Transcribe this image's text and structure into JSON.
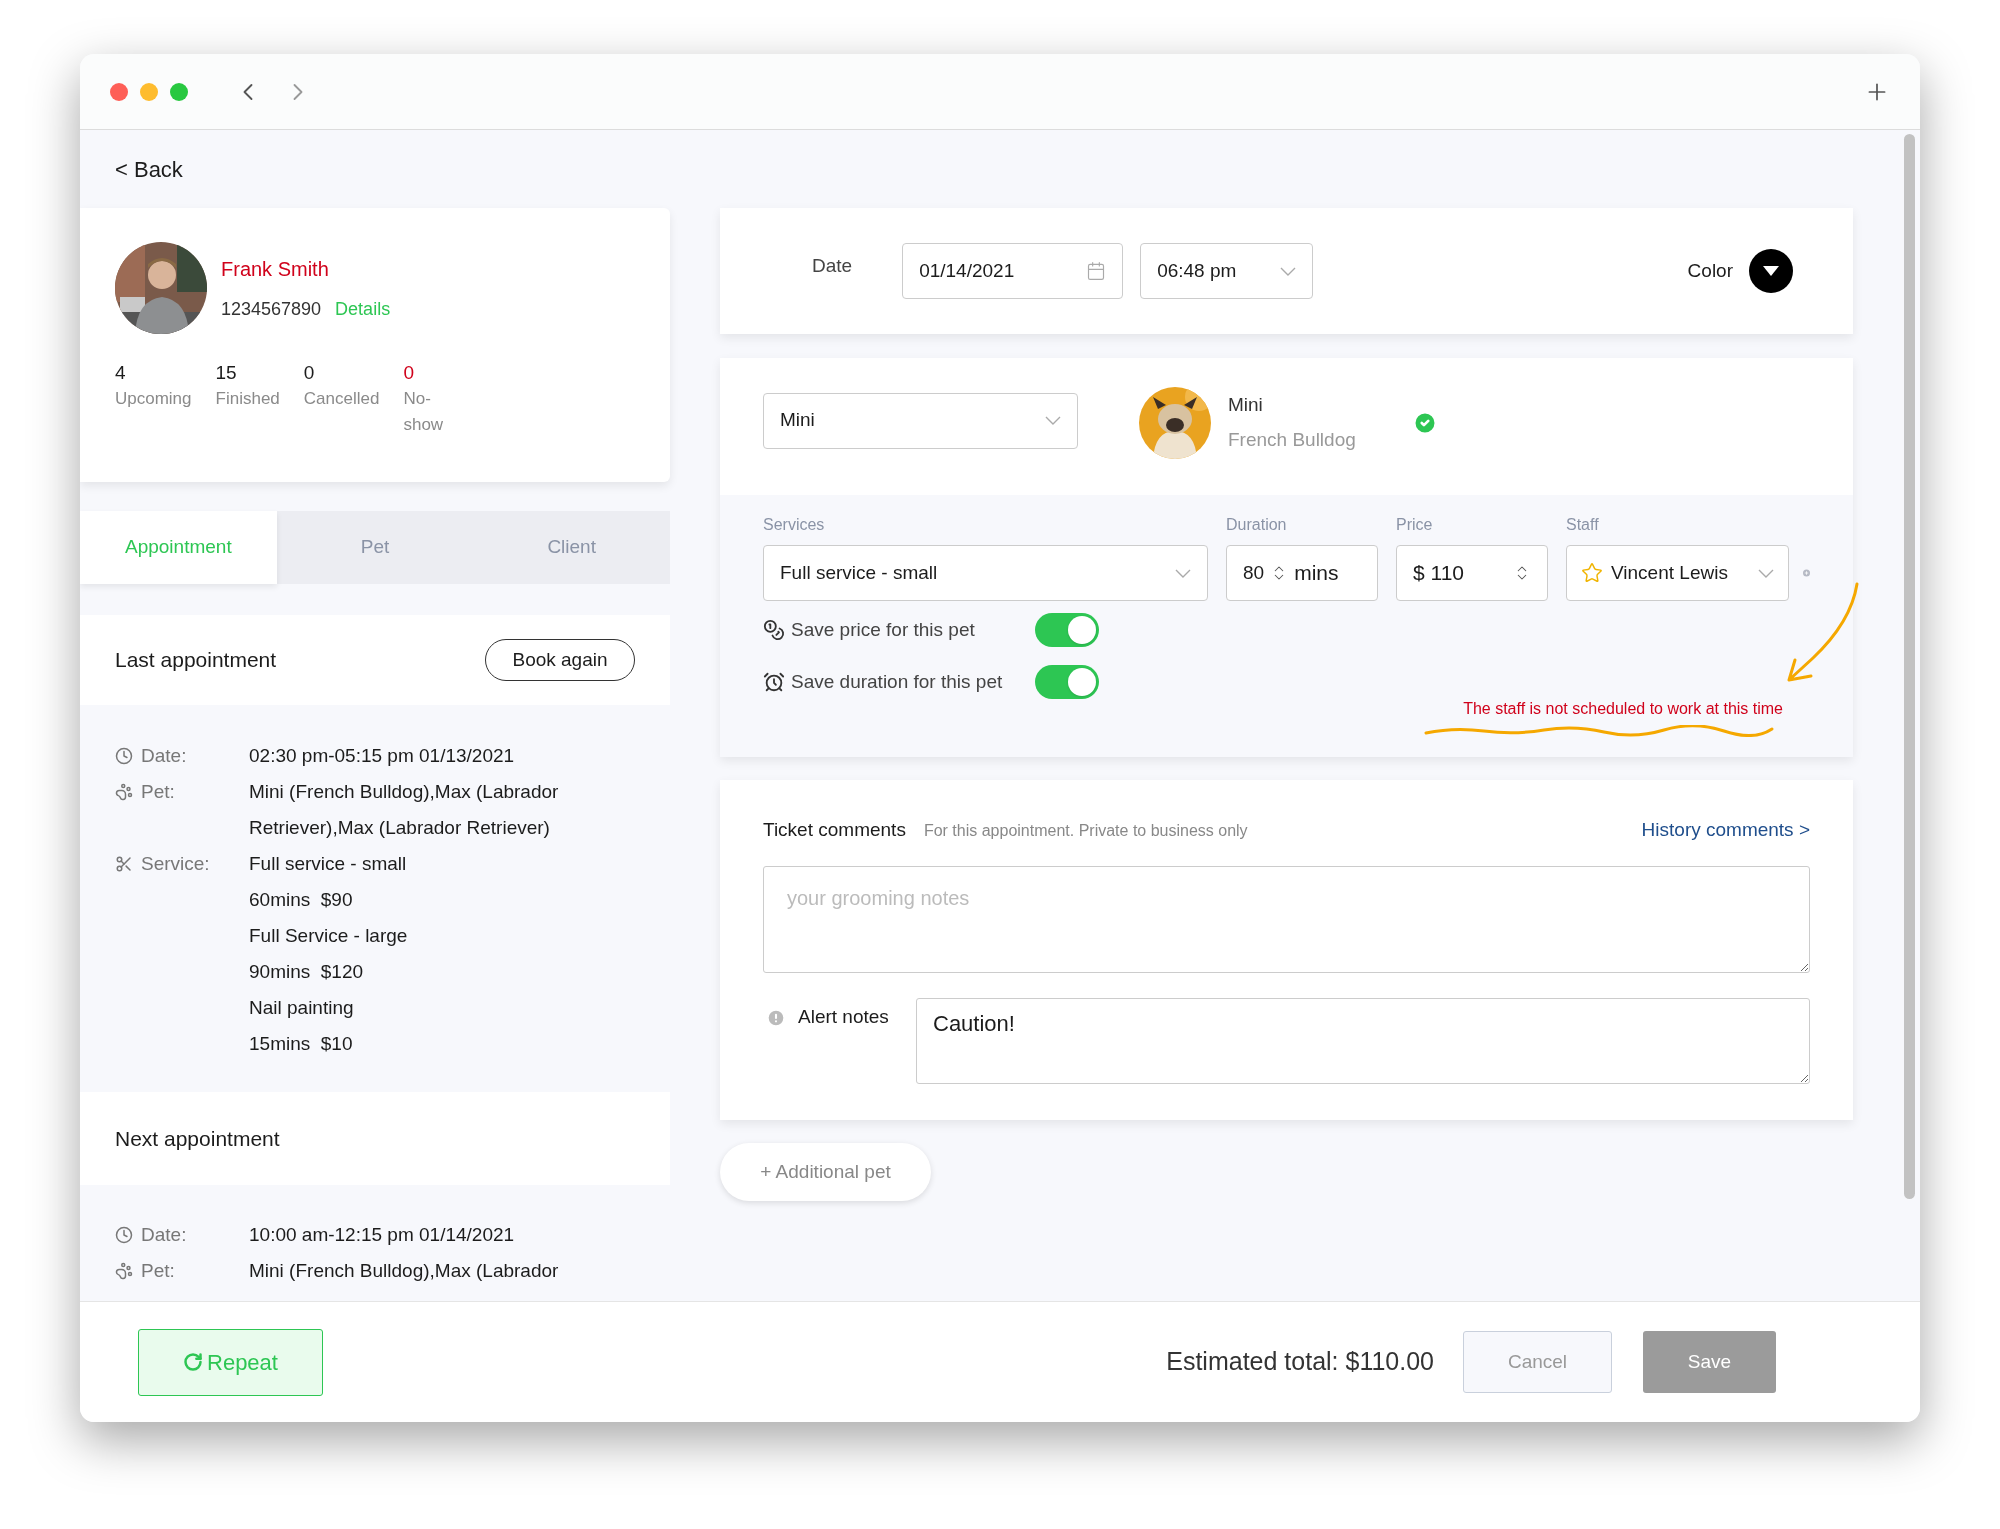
{
  "back_link": "< Back",
  "client": {
    "name": "Frank Smith",
    "phone": "1234567890",
    "details_link": "Details",
    "stats": [
      {
        "value": "4",
        "label": "Upcoming",
        "alert": false
      },
      {
        "value": "15",
        "label": "Finished",
        "alert": false
      },
      {
        "value": "0",
        "label": "Cancelled",
        "alert": false
      },
      {
        "value": "0",
        "label": "No-show",
        "alert": true
      }
    ]
  },
  "tabs": [
    {
      "label": "Appointment",
      "selected": true
    },
    {
      "label": "Pet",
      "selected": false
    },
    {
      "label": "Client",
      "selected": false
    }
  ],
  "last_appointment": {
    "title": "Last appointment",
    "button": "Book again",
    "rows": [
      {
        "kind": "date",
        "label": "Date:",
        "lines": [
          "02:30 pm-05:15 pm 01/13/2021"
        ]
      },
      {
        "kind": "pet",
        "label": "Pet:",
        "lines": [
          "Mini (French Bulldog),Max (Labrador Retriever),Max (Labrador Retriever)"
        ]
      },
      {
        "kind": "service",
        "label": "Service:",
        "lines": [
          "Full service - small",
          "60mins  $90",
          "Full Service - large",
          "90mins  $120",
          "Nail painting",
          "15mins  $10"
        ]
      }
    ]
  },
  "next_appointment": {
    "title": "Next appointment",
    "rows": [
      {
        "kind": "date",
        "label": "Date:",
        "lines": [
          "10:00 am-12:15 pm 01/14/2021"
        ]
      },
      {
        "kind": "pet",
        "label": "Pet:",
        "lines": [
          "Mini (French Bulldog),Max (Labrador"
        ]
      }
    ]
  },
  "schedule": {
    "date_label": "Date",
    "date": "01/14/2021",
    "time": "06:48 pm",
    "color_label": "Color"
  },
  "pet": {
    "select": "Mini",
    "name": "Mini",
    "breed": "French Bulldog",
    "verified": true
  },
  "service": {
    "services_label": "Services",
    "service": "Full service - small",
    "duration_label": "Duration",
    "duration": "80",
    "duration_unit": "mins",
    "price_label": "Price",
    "price_prefix": "$",
    "price": "110",
    "staff_label": "Staff",
    "staff": "Vincent Lewis",
    "toggles": [
      {
        "kind": "price",
        "label": "Save price for this pet",
        "on": true
      },
      {
        "kind": "duration",
        "label": "Save duration for this pet",
        "on": true
      }
    ],
    "warning": "The staff is not scheduled to work at this time"
  },
  "comments": {
    "title": "Ticket comments",
    "hint": "For this appointment. Private to business only",
    "history_link": "History comments >",
    "placeholder": "your grooming notes",
    "alert_label": "Alert notes",
    "alert_value": "Caution!"
  },
  "additional_pet_button": "+ Additional pet",
  "footer": {
    "repeat": "Repeat",
    "estimated_total": "Estimated total: $110.00",
    "cancel": "Cancel",
    "save": "Save"
  }
}
